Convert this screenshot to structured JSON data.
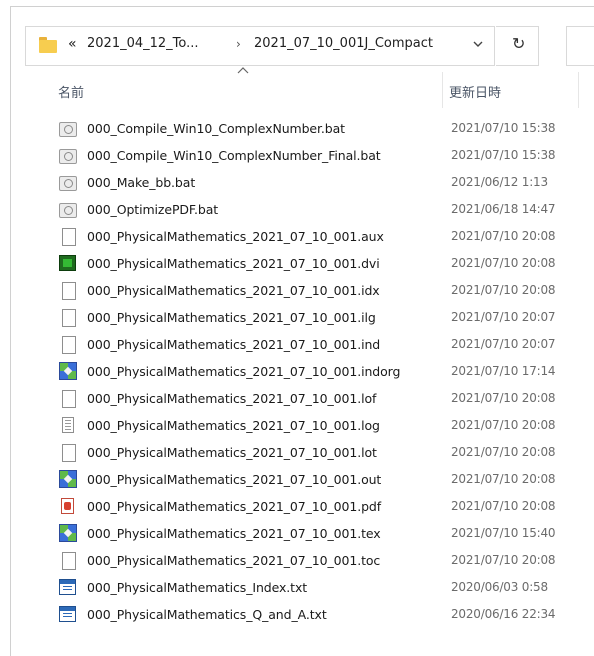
{
  "address_bar": {
    "overflow_chevron": "«",
    "segment_1": "2021_04_12_To...",
    "separator": "›",
    "segment_2": "2021_07_10_001J_Compact",
    "refresh_glyph": "↻"
  },
  "columns": {
    "name": "名前",
    "date_modified": "更新日時"
  },
  "files": [
    {
      "icon": "bat-icon",
      "name": "000_Compile_Win10_ComplexNumber.bat",
      "date": "2021/07/10 15:38"
    },
    {
      "icon": "bat-icon",
      "name": "000_Compile_Win10_ComplexNumber_Final.bat",
      "date": "2021/07/10 15:38"
    },
    {
      "icon": "bat-icon",
      "name": "000_Make_bb.bat",
      "date": "2021/06/12 1:13"
    },
    {
      "icon": "bat-icon",
      "name": "000_OptimizePDF.bat",
      "date": "2021/06/18 14:47"
    },
    {
      "icon": "blank-file-icon",
      "name": "000_PhysicalMathematics_2021_07_10_001.aux",
      "date": "2021/07/10 20:08"
    },
    {
      "icon": "dvi-viewer-icon",
      "name": "000_PhysicalMathematics_2021_07_10_001.dvi",
      "date": "2021/07/10 20:08"
    },
    {
      "icon": "blank-file-icon",
      "name": "000_PhysicalMathematics_2021_07_10_001.idx",
      "date": "2021/07/10 20:08"
    },
    {
      "icon": "blank-file-icon",
      "name": "000_PhysicalMathematics_2021_07_10_001.ilg",
      "date": "2021/07/10 20:07"
    },
    {
      "icon": "blank-file-icon",
      "name": "000_PhysicalMathematics_2021_07_10_001.ind",
      "date": "2021/07/10 20:07"
    },
    {
      "icon": "tex-editor-icon",
      "name": "000_PhysicalMathematics_2021_07_10_001.indorg",
      "date": "2021/07/10 17:14"
    },
    {
      "icon": "blank-file-icon",
      "name": "000_PhysicalMathematics_2021_07_10_001.lof",
      "date": "2021/07/10 20:08"
    },
    {
      "icon": "log-file-icon",
      "name": "000_PhysicalMathematics_2021_07_10_001.log",
      "date": "2021/07/10 20:08"
    },
    {
      "icon": "blank-file-icon",
      "name": "000_PhysicalMathematics_2021_07_10_001.lot",
      "date": "2021/07/10 20:08"
    },
    {
      "icon": "tex-editor-icon",
      "name": "000_PhysicalMathematics_2021_07_10_001.out",
      "date": "2021/07/10 20:08"
    },
    {
      "icon": "pdf-icon",
      "name": "000_PhysicalMathematics_2021_07_10_001.pdf",
      "date": "2021/07/10 20:08"
    },
    {
      "icon": "tex-editor-icon",
      "name": "000_PhysicalMathematics_2021_07_10_001.tex",
      "date": "2021/07/10 15:40"
    },
    {
      "icon": "blank-file-icon",
      "name": "000_PhysicalMathematics_2021_07_10_001.toc",
      "date": "2021/07/10 20:08"
    },
    {
      "icon": "text-file-icon",
      "name": "000_PhysicalMathematics_Index.txt",
      "date": "2020/06/03 0:58"
    },
    {
      "icon": "text-file-icon",
      "name": "000_PhysicalMathematics_Q_and_A.txt",
      "date": "2020/06/16 22:34"
    }
  ]
}
